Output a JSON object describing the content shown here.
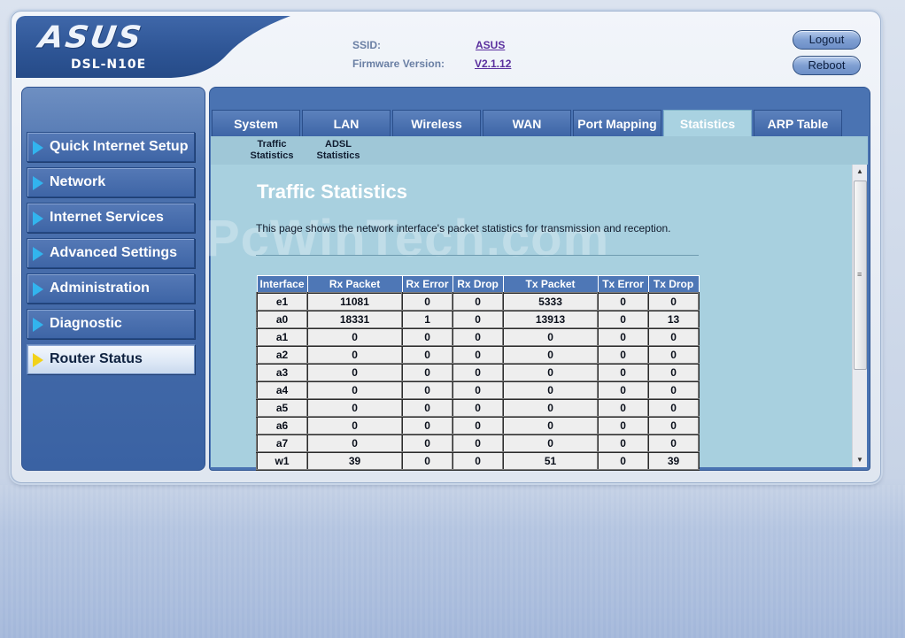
{
  "header": {
    "brand": "ASUS",
    "model": "DSL-N10E",
    "ssid_label": "SSID:",
    "ssid_value": "ASUS",
    "firmware_label": "Firmware Version:",
    "firmware_value": "V2.1.12",
    "logout_label": "Logout",
    "reboot_label": "Reboot"
  },
  "sidebar": {
    "items": [
      {
        "label": "Quick Internet Setup",
        "active": false
      },
      {
        "label": "Network",
        "active": false
      },
      {
        "label": "Internet Services",
        "active": false
      },
      {
        "label": "Advanced Settings",
        "active": false
      },
      {
        "label": "Administration",
        "active": false
      },
      {
        "label": "Diagnostic",
        "active": false
      },
      {
        "label": "Router Status",
        "active": true
      }
    ]
  },
  "tabs": [
    {
      "label": "System"
    },
    {
      "label": "LAN"
    },
    {
      "label": "Wireless"
    },
    {
      "label": "WAN"
    },
    {
      "label": "Port Mapping"
    },
    {
      "label": "Statistics",
      "active": true
    },
    {
      "label": "ARP Table"
    }
  ],
  "subtabs": [
    {
      "line1": "Traffic",
      "line2": "Statistics"
    },
    {
      "line1": "ADSL",
      "line2": "Statistics"
    }
  ],
  "content": {
    "watermark": "PcWinTech.com",
    "title": "Traffic Statistics",
    "description": "This page shows the network interface's packet statistics for transmission and reception."
  },
  "table": {
    "headers": [
      "Interface",
      "Rx Packet",
      "Rx Error",
      "Rx Drop",
      "Tx Packet",
      "Tx Error",
      "Tx Drop"
    ],
    "rows": [
      [
        "e1",
        "11081",
        "0",
        "0",
        "5333",
        "0",
        "0"
      ],
      [
        "a0",
        "18331",
        "1",
        "0",
        "13913",
        "0",
        "13"
      ],
      [
        "a1",
        "0",
        "0",
        "0",
        "0",
        "0",
        "0"
      ],
      [
        "a2",
        "0",
        "0",
        "0",
        "0",
        "0",
        "0"
      ],
      [
        "a3",
        "0",
        "0",
        "0",
        "0",
        "0",
        "0"
      ],
      [
        "a4",
        "0",
        "0",
        "0",
        "0",
        "0",
        "0"
      ],
      [
        "a5",
        "0",
        "0",
        "0",
        "0",
        "0",
        "0"
      ],
      [
        "a6",
        "0",
        "0",
        "0",
        "0",
        "0",
        "0"
      ],
      [
        "a7",
        "0",
        "0",
        "0",
        "0",
        "0",
        "0"
      ],
      [
        "w1",
        "39",
        "0",
        "0",
        "51",
        "0",
        "39"
      ]
    ]
  },
  "icons": {
    "menu_arrow": "triangle-right-icon",
    "scroll_up": "triangle-up-icon",
    "scroll_down": "triangle-down-icon"
  },
  "colors": {
    "menu_arrow": "#32b4ee",
    "menu_arrow_active": "#f2d21a",
    "header_blue": "#2d5494",
    "content_bg": "#a8d0df",
    "table_header": "#4e77b6"
  }
}
